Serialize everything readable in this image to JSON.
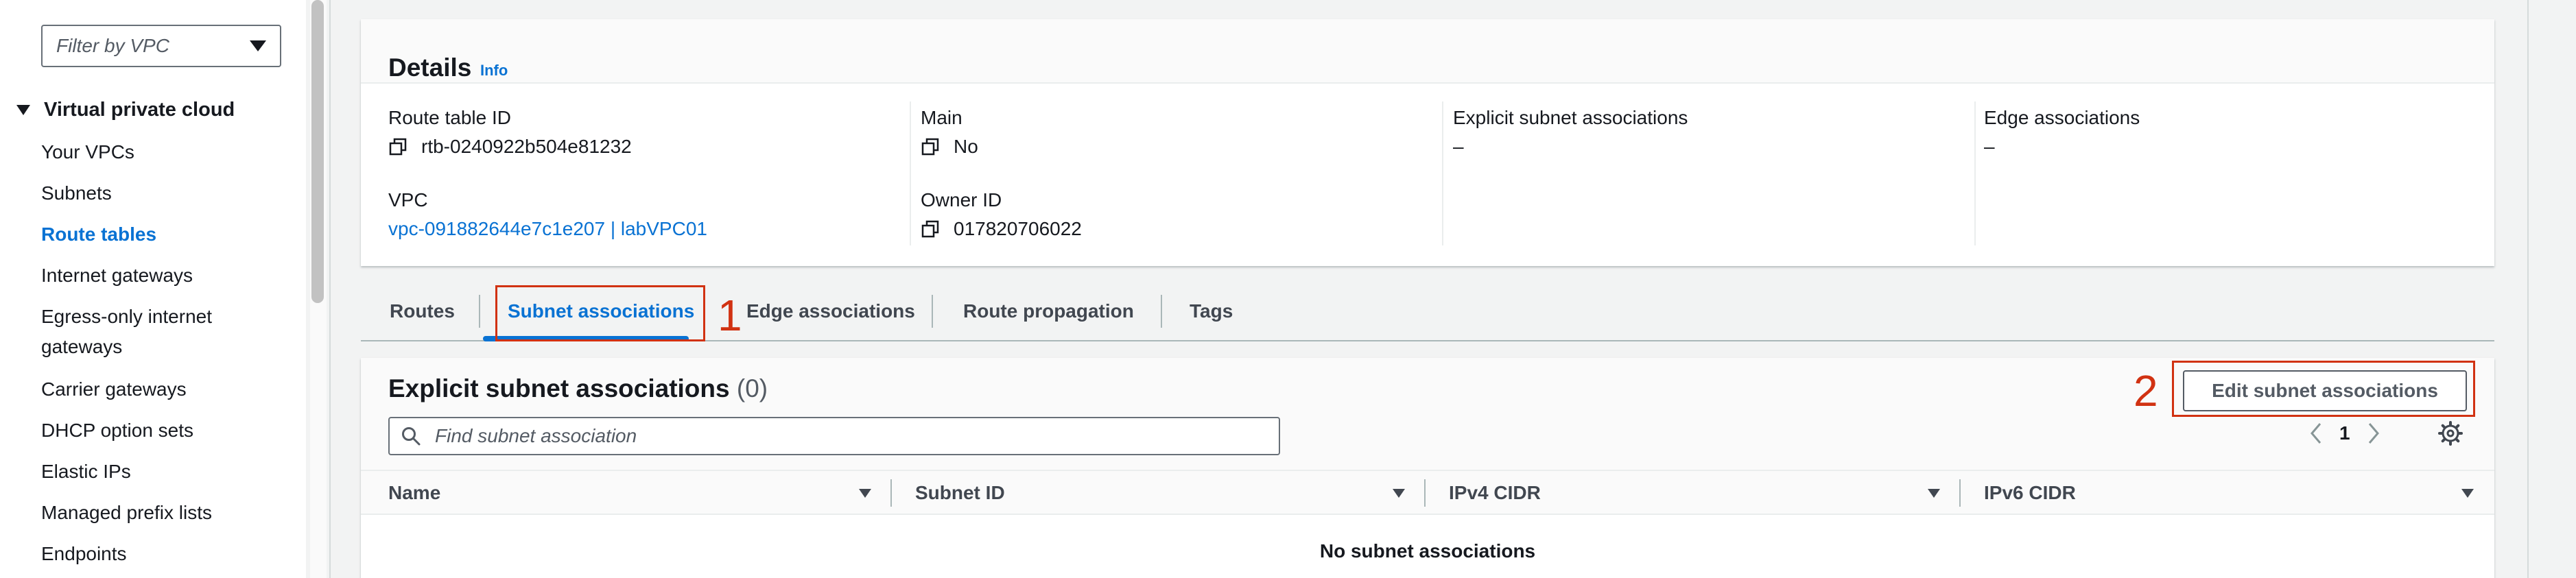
{
  "sidebar": {
    "filter_placeholder": "Filter by VPC",
    "section_title": "Virtual private cloud",
    "items": [
      {
        "label": "Your VPCs"
      },
      {
        "label": "Subnets"
      },
      {
        "label": "Route tables"
      },
      {
        "label": "Internet gateways"
      },
      {
        "label": "Egress-only internet gateways"
      },
      {
        "label": "Carrier gateways"
      },
      {
        "label": "DHCP option sets"
      },
      {
        "label": "Elastic IPs"
      },
      {
        "label": "Managed prefix lists"
      },
      {
        "label": "Endpoints"
      }
    ],
    "active_item": "Route tables"
  },
  "details": {
    "title": "Details",
    "info": "Info",
    "route_table_id_label": "Route table ID",
    "route_table_id": "rtb-0240922b504e81232",
    "main_label": "Main",
    "main_value": "No",
    "explicit_label": "Explicit subnet associations",
    "explicit_value": "–",
    "edge_label": "Edge associations",
    "edge_value": "–",
    "vpc_label": "VPC",
    "vpc_value": "vpc-091882644e7c1e207 | labVPC01",
    "owner_label": "Owner ID",
    "owner_value": "017820706022"
  },
  "tabs": [
    {
      "label": "Routes"
    },
    {
      "label": "Subnet associations"
    },
    {
      "label": "Edge associations"
    },
    {
      "label": "Route propagation"
    },
    {
      "label": "Tags"
    }
  ],
  "active_tab": "Subnet associations",
  "annotations": {
    "step1": "1",
    "step2": "2"
  },
  "assoc": {
    "title": "Explicit subnet associations",
    "count": "(0)",
    "search_placeholder": "Find subnet association",
    "edit_button": "Edit subnet associations",
    "page": "1",
    "columns": [
      "Name",
      "Subnet ID",
      "IPv4 CIDR",
      "IPv6 CIDR"
    ],
    "empty_message": "No subnet associations"
  },
  "colors": {
    "link": "#0972d3",
    "annotation": "#d13212",
    "text": "#16191f"
  },
  "icons": [
    "copy-icon",
    "search-icon",
    "chevron-left-icon",
    "chevron-right-icon",
    "gear-icon",
    "caret-down-icon"
  ]
}
